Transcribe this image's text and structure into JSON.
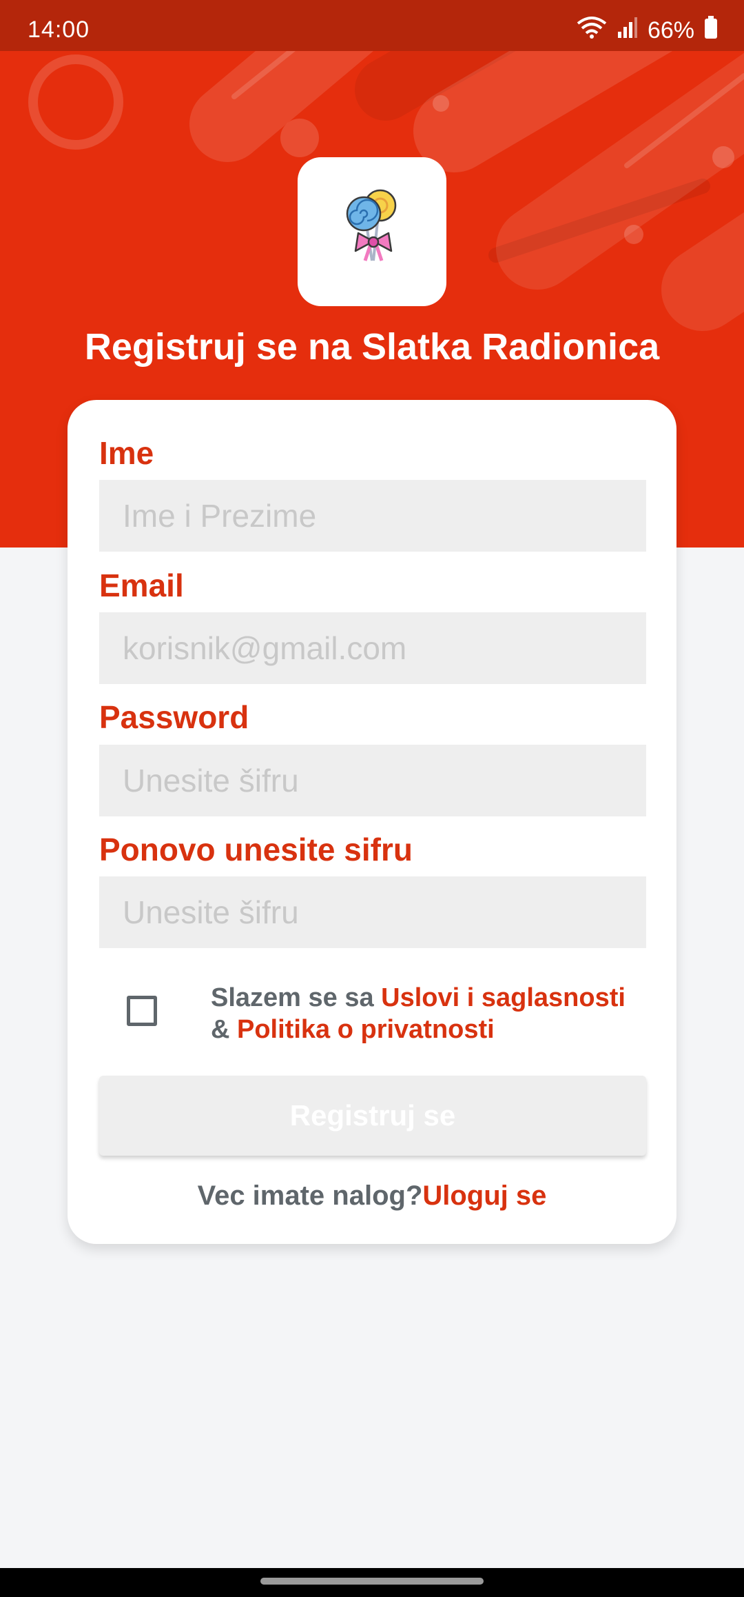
{
  "status_bar": {
    "time": "14:00",
    "battery": "66%"
  },
  "header": {
    "title": "Registruj se na Slatka Radionica",
    "logo_icon": "lollipop-icon"
  },
  "form": {
    "fields": [
      {
        "label": "Ime",
        "placeholder": "Ime i Prezime"
      },
      {
        "label": "Email",
        "placeholder": "korisnik@gmail.com"
      },
      {
        "label": "Password",
        "placeholder": "Unesite šifru"
      },
      {
        "label": "Ponovo unesite sifru",
        "placeholder": "Unesite šifru"
      }
    ],
    "terms": {
      "prefix": "Slazem se sa ",
      "terms_link": "Uslovi i saglasnosti",
      "ampersand": "& ",
      "privacy_link": "Politika o privatnosti"
    },
    "register_label": "Registruj se",
    "login_prompt": "Vec imate nalog?",
    "login_link": "Uloguj se"
  },
  "colors": {
    "accent": "#e52e0d",
    "label": "#d8320f",
    "status_bar": "#b4260b",
    "background": "#f4f5f7",
    "input_bg": "#eeeeee"
  }
}
